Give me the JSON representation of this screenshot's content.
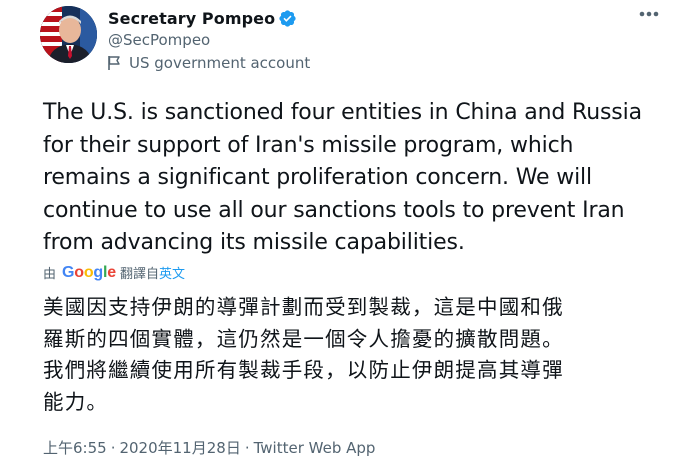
{
  "author": {
    "display_name": "Secretary Pompeo",
    "handle": "@SecPompeo",
    "account_label": "US government account",
    "verified_icon": "verified-badge-icon",
    "avatar_icon": "avatar"
  },
  "tweet": {
    "text": "The U.S. is sanctioned four entities in China and Russia\nfor their support of Iran's missile program, which\nremains a significant proliferation concern. We will\ncontinue to use all our sanctions tools to prevent Iran\nfrom advancing its missile capabilities."
  },
  "translation": {
    "prefix": "由",
    "provider": "Google",
    "label": "翻譯自",
    "language": "英文",
    "text": "美國因支持伊朗的導彈計劃而受到製裁，這是中國和俄\n羅斯的四個實體，這仍然是一個令人擔憂的擴散問題。\n我們將繼續使用所有製裁手段，以防止伊朗提高其導彈\n能力。"
  },
  "meta": {
    "time": "上午6:55",
    "separator": "·",
    "date": "2020年11月28日",
    "source": "Twitter Web App"
  },
  "colors": {
    "text": "#0f1419",
    "secondary": "#536471",
    "accent": "#1d9bf0",
    "verified": "#1d9bf0"
  }
}
